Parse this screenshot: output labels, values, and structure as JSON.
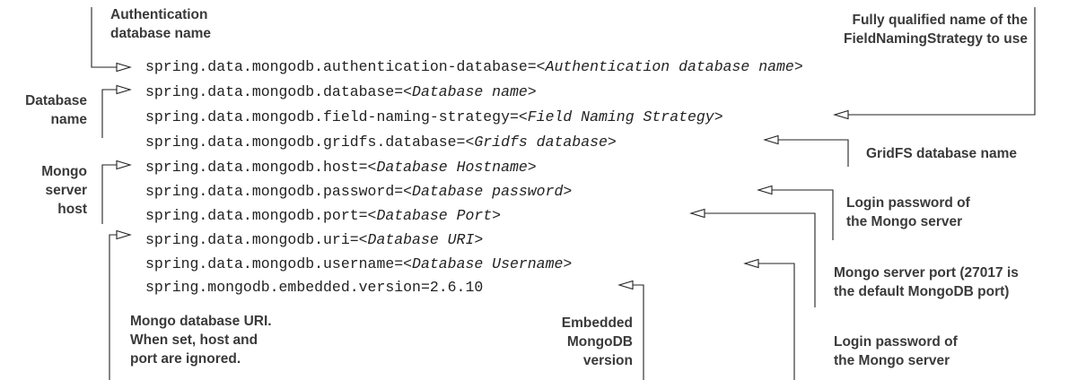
{
  "code_lines": [
    {
      "key": "spring.data.mongodb.authentication-database=",
      "value": "<Authentication database name>"
    },
    {
      "key": "spring.data.mongodb.database=",
      "value": "<Database name>"
    },
    {
      "key": "spring.data.mongodb.field-naming-strategy=",
      "value": "<Field Naming Strategy>"
    },
    {
      "key": "spring.data.mongodb.gridfs.database=",
      "value": "<Gridfs database>"
    },
    {
      "key": "spring.data.mongodb.host=",
      "value": "<Database Hostname>"
    },
    {
      "key": "spring.data.mongodb.password=",
      "value": "<Database password>"
    },
    {
      "key": "spring.data.mongodb.port=",
      "value": "<Database Port>"
    },
    {
      "key": "spring.data.mongodb.uri=",
      "value": "<Database URI>"
    },
    {
      "key": "spring.data.mongodb.username=",
      "value": "<Database Username>"
    },
    {
      "key": "spring.mongodb.embedded.version=2.6.10",
      "value": ""
    }
  ],
  "annotations": {
    "auth_db": [
      "Authentication",
      "database name"
    ],
    "database_name": [
      "Database",
      "name"
    ],
    "mongo_host": [
      "Mongo",
      "server",
      "host"
    ],
    "mongo_uri": [
      "Mongo database URI.",
      "When set, host and",
      "port are ignored."
    ],
    "embedded_version": [
      "Embedded",
      "MongoDB",
      "version"
    ],
    "field_naming": [
      "Fully qualified name of the",
      "FieldNamingStrategy to use"
    ],
    "gridfs": [
      "GridFS database name"
    ],
    "password": [
      "Login password of",
      "the Mongo server"
    ],
    "port": [
      "Mongo server port (27017 is",
      "the default MongoDB port)"
    ],
    "username": [
      "Login password of",
      "the Mongo server"
    ]
  },
  "colors": {
    "text": "#3a3a3a",
    "code": "#222222",
    "line": "#222222",
    "background": "#ffffff"
  }
}
